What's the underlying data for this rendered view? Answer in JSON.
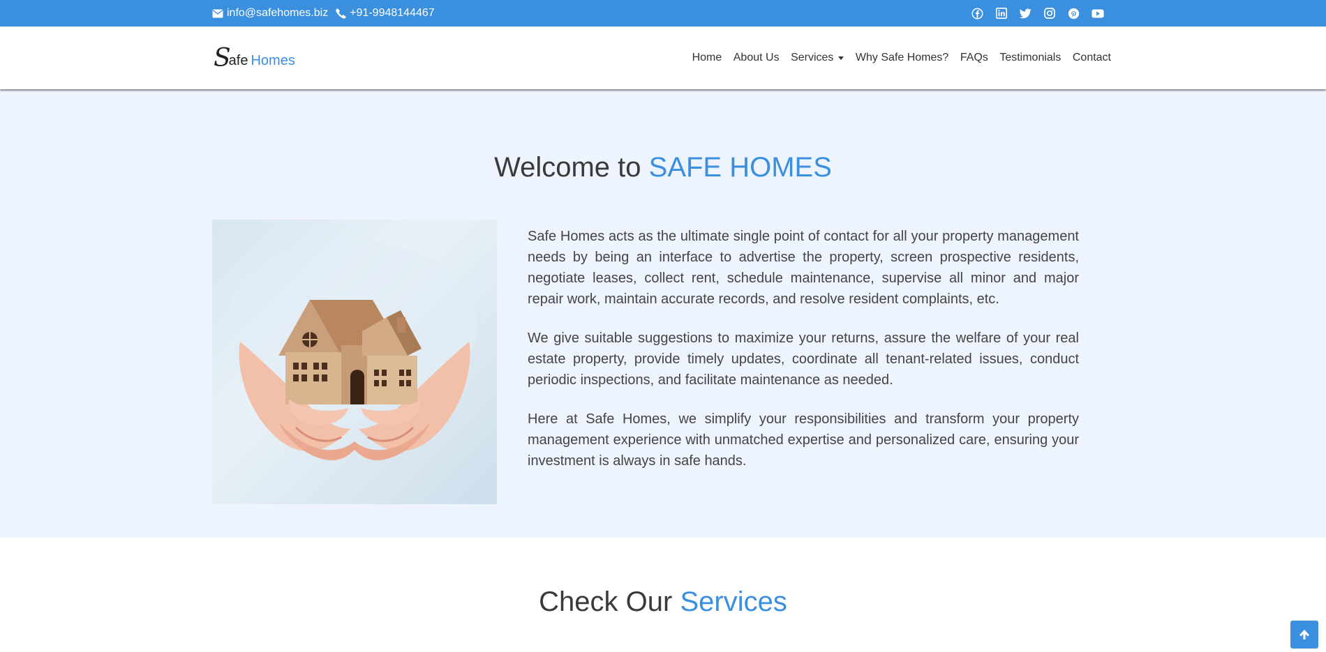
{
  "topbar": {
    "email": "info@safehomes.biz",
    "phone": "+91-9948144467",
    "social": [
      "facebook-icon",
      "linkedin-icon",
      "twitter-icon",
      "instagram-icon",
      "pinterest-icon",
      "youtube-icon"
    ]
  },
  "header": {
    "logo": {
      "s": "S",
      "afe": "afe",
      "homes": "Homes"
    },
    "nav": [
      "Home",
      "About Us",
      "Services",
      "Why Safe Homes?",
      "FAQs",
      "Testimonials",
      "Contact"
    ]
  },
  "welcome": {
    "title_prefix": "Welcome to ",
    "title_accent": "SAFE HOMES",
    "paragraphs": [
      "Safe Homes acts as the ultimate single point of contact for all your property management needs by being an interface to advertise the property, screen prospective residents, negotiate leases, collect rent, schedule maintenance, supervise all minor and major repair work, maintain accurate records, and resolve resident complaints, etc.",
      "We give suitable suggestions to maximize your returns, assure the welfare of your real estate property, provide timely updates, coordinate all tenant-related issues, conduct periodic inspections, and facilitate maintenance as needed.",
      "Here at Safe Homes, we simplify your responsibilities and transform your property management experience with unmatched expertise and personalized care, ensuring your investment is always in safe hands."
    ]
  },
  "services": {
    "title_prefix": "Check Our ",
    "title_accent": "Services"
  },
  "colors": {
    "accent": "#3b8fdf",
    "section_bg": "#eef4fd",
    "text": "#444444"
  }
}
